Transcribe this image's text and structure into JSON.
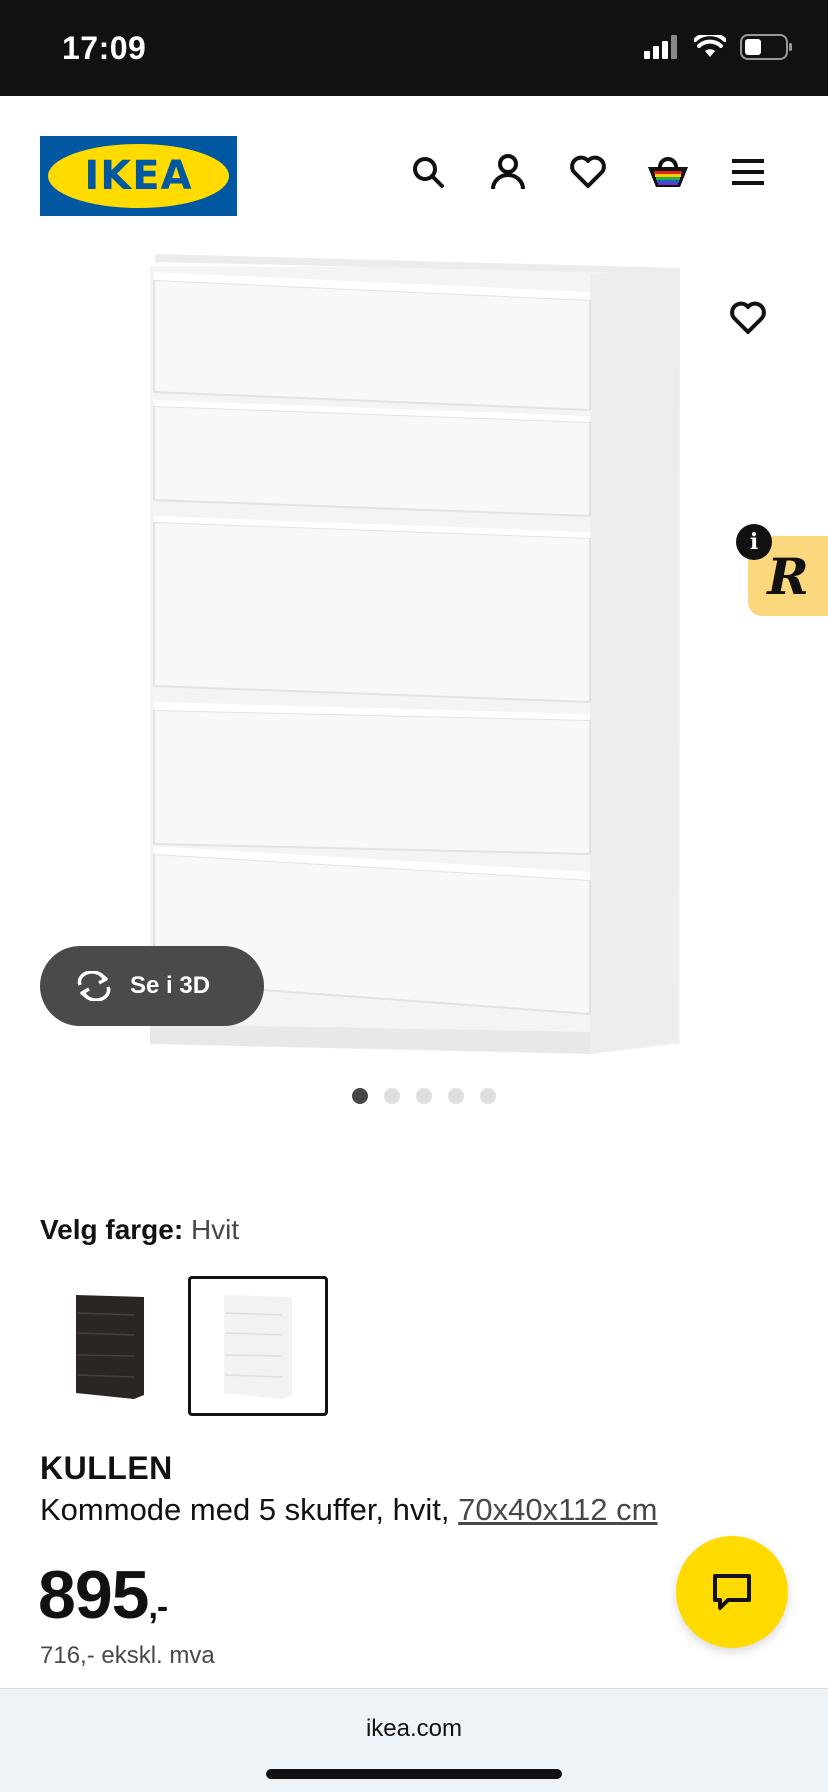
{
  "status_bar": {
    "time": "17:09"
  },
  "header": {
    "logo_text": "IKEA",
    "icons": [
      "search-icon",
      "user-icon",
      "heart-icon",
      "basket-icon",
      "menu-icon"
    ]
  },
  "gallery": {
    "view_3d_label": "Se i 3D",
    "total_images": 5,
    "active_index": 0,
    "badge_letter": "R",
    "info_letter": "i"
  },
  "color_picker": {
    "label": "Velg farge:",
    "selected_value": "Hvit",
    "options": [
      "black-brown",
      "white"
    ]
  },
  "product": {
    "name": "KULLEN",
    "description": "Kommode med 5 skuffer, hvit,",
    "dimensions_link": "70x40x112 cm",
    "price": "895",
    "price_suffix": ",-",
    "price_ex_vat": "716,- ekskl. mva"
  },
  "browser": {
    "url": "ikea.com"
  },
  "colors": {
    "ikea_blue": "#0058a3",
    "ikea_yellow": "#ffdb00",
    "badge_yellow": "#fbd87e"
  }
}
